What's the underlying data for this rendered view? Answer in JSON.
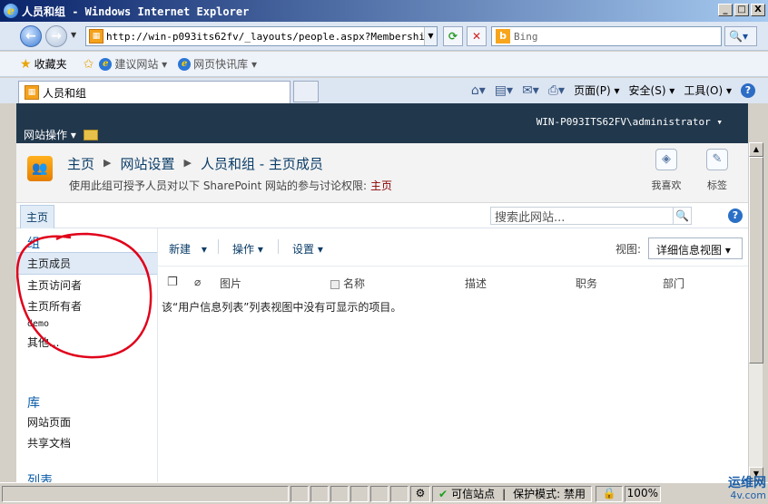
{
  "window": {
    "title": "人员和组 - Windows Internet Explorer",
    "min_label": "_",
    "max_label": "□",
    "close_label": "X"
  },
  "address": {
    "url": "http://win-p093its62fv/_layouts/people.aspx?MembershipGrou",
    "search_placeholder": "Bing"
  },
  "favorites": {
    "label": "收藏夹",
    "items": [
      "建议网站 ▾",
      "网页快讯库 ▾"
    ]
  },
  "tab": {
    "title": "人员和组"
  },
  "command_bar": {
    "page": "页面(P) ▾",
    "safety": "安全(S) ▾",
    "tools": "工具(O) ▾"
  },
  "sharepoint": {
    "user": "WIN-P093ITS62FV\\administrator ▾",
    "site_actions": "网站操作 ▾",
    "breadcrumb": [
      "主页",
      "网站设置",
      "人员和组 - 主页成员"
    ],
    "description": "使用此组可授予人员对以下 SharePoint 网站的参与讨论权限:",
    "description_link": "主页",
    "social": {
      "like": "我喜欢",
      "tags": "标签"
    },
    "home_tab": "主页",
    "search_placeholder": "搜索此网站..."
  },
  "leftnav": {
    "groups_header": "组",
    "groups": [
      "主页成员",
      "主页访问者",
      "主页所有者",
      "demo",
      "其他..."
    ],
    "libraries_header": "库",
    "libraries": [
      "网站页面",
      "共享文档"
    ],
    "lists_header": "列表"
  },
  "toolbar": {
    "new": "新建",
    "actions": "操作 ▾",
    "settings": "设置 ▾",
    "view_label": "视图:",
    "view_value": "详细信息视图 ▾"
  },
  "columns": [
    "图片",
    "名称",
    "描述",
    "职务",
    "部门"
  ],
  "empty_message": "该“用户信息列表”列表视图中没有可显示的项目。",
  "status": {
    "trusted": "可信站点",
    "protected_mode": "保护模式: 禁用",
    "zoom": "100%"
  },
  "watermark": {
    "line1": "运维网",
    "line2": "4v.com"
  },
  "colors": {
    "sp_header": "#21374c",
    "annotation_red": "#e0001a"
  }
}
